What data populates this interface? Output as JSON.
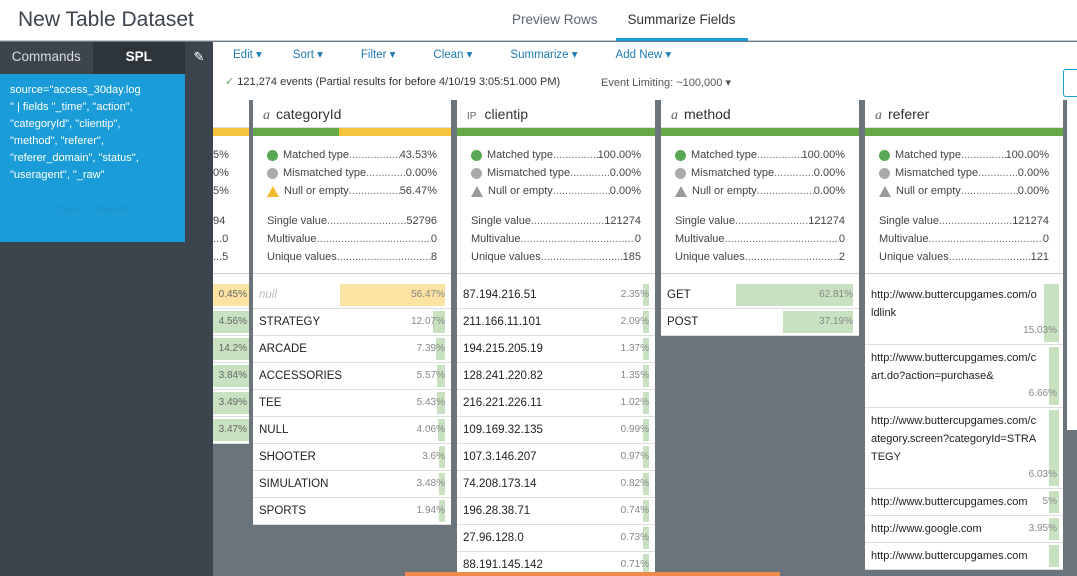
{
  "title": "New Table Dataset",
  "tabs": [
    {
      "label": "Preview Rows",
      "active": false
    },
    {
      "label": "Summarize Fields",
      "active": true
    }
  ],
  "left": {
    "tab_commands": "Commands",
    "tab_spl": "SPL",
    "spl": "source=\"access_30day.log\n\" | fields \"_time\", \"action\",\n\"categoryId\", \"clientip\",\n\"method\", \"referer\",\n\"referer_domain\", \"status\",\n\"useragent\", \"_raw\"",
    "open_in_search": "Open in Search"
  },
  "toolbar": {
    "menus": [
      "Edit",
      "Sort",
      "Filter",
      "Clean",
      "Summarize",
      "Add New"
    ],
    "status": "121,274 events (Partial results for before 4/10/19 3:05:51.000 PM)",
    "event_limit": "Event Limiting: ~100,000"
  },
  "partial_col": {
    "stats": [
      "5%",
      "0%",
      "5%",
      "94",
      "...0",
      "...5"
    ],
    "rows": [
      "0.45%",
      "4.56%",
      "14.2%",
      "3.84%",
      "3.49%",
      "3.47%"
    ]
  },
  "columns": [
    {
      "type_label": "a",
      "name": "categoryId",
      "matched_fraction": 0.4353,
      "matched": "43.53%",
      "mismatched": "0.00%",
      "null": "56.47%",
      "null_warn": true,
      "single": "52796",
      "multi": "0",
      "unique": "8",
      "rows": [
        {
          "label": "null",
          "pct": "56.47%",
          "frac": 0.5647,
          "null": true
        },
        {
          "label": "STRATEGY",
          "pct": "12.07%",
          "frac": 0.1207
        },
        {
          "label": "ARCADE",
          "pct": "7.39%",
          "frac": 0.0739
        },
        {
          "label": "ACCESSORIES",
          "pct": "5.57%",
          "frac": 0.0557
        },
        {
          "label": "TEE",
          "pct": "5.43%",
          "frac": 0.0543
        },
        {
          "label": "NULL",
          "pct": "4.06%",
          "frac": 0.0406
        },
        {
          "label": "SHOOTER",
          "pct": "3.6%",
          "frac": 0.036
        },
        {
          "label": "SIMULATION",
          "pct": "3.48%",
          "frac": 0.0348
        },
        {
          "label": "SPORTS",
          "pct": "1.94%",
          "frac": 0.0194
        }
      ]
    },
    {
      "type_label": "IP",
      "name": "clientip",
      "matched_fraction": 1.0,
      "matched": "100.00%",
      "mismatched": "0.00%",
      "null": "0.00%",
      "null_warn": false,
      "single": "121274",
      "multi": "0",
      "unique": "185",
      "rows": [
        {
          "label": "87.194.216.51",
          "pct": "2.35%",
          "frac": 0.0235
        },
        {
          "label": "211.166.11.101",
          "pct": "2.09%",
          "frac": 0.0209
        },
        {
          "label": "194.215.205.19",
          "pct": "1.37%",
          "frac": 0.0137
        },
        {
          "label": "128.241.220.82",
          "pct": "1.35%",
          "frac": 0.0135
        },
        {
          "label": "216.221.226.11",
          "pct": "1.02%",
          "frac": 0.0102
        },
        {
          "label": "109.169.32.135",
          "pct": "0.99%",
          "frac": 0.0099
        },
        {
          "label": "107.3.146.207",
          "pct": "0.97%",
          "frac": 0.0097
        },
        {
          "label": "74.208.173.14",
          "pct": "0.82%",
          "frac": 0.0082
        },
        {
          "label": "196.28.38.71",
          "pct": "0.74%",
          "frac": 0.0074
        },
        {
          "label": "27.96.128.0",
          "pct": "0.73%",
          "frac": 0.0073
        },
        {
          "label": "88.191.145.142",
          "pct": "0.71%",
          "frac": 0.0071
        }
      ]
    },
    {
      "type_label": "a",
      "name": "method",
      "matched_fraction": 1.0,
      "matched": "100.00%",
      "mismatched": "0.00%",
      "null": "0.00%",
      "null_warn": false,
      "single": "121274",
      "multi": "0",
      "unique": "2",
      "rows": [
        {
          "label": "GET",
          "pct": "62.81%",
          "frac": 0.6281
        },
        {
          "label": "POST",
          "pct": "37.19%",
          "frac": 0.3719
        }
      ]
    },
    {
      "type_label": "a",
      "name": "referer",
      "matched_fraction": 1.0,
      "matched": "100.00%",
      "mismatched": "0.00%",
      "null": "0.00%",
      "null_warn": false,
      "single": "121274",
      "multi": "0",
      "unique": "121",
      "rows": [
        {
          "label": "http://www.buttercupgames.com/oldlink",
          "pct": "15.03%",
          "frac": 0.1503
        },
        {
          "label": "http://www.buttercupgames.com/cart.do?action=purchase&",
          "pct": "6.66%",
          "frac": 0.0666
        },
        {
          "label": "http://www.buttercupgames.com/category.screen?categoryId=STRATEGY",
          "pct": "6.03%",
          "frac": 0.0603
        },
        {
          "label": "http://www.buttercupgames.com",
          "pct": "5%",
          "frac": 0.05,
          "one": true
        },
        {
          "label": "http://www.google.com",
          "pct": "3.95%",
          "frac": 0.0395,
          "one": true
        },
        {
          "label": "http://www.buttercupgames.com",
          "pct": "",
          "frac": 0.03
        }
      ]
    }
  ],
  "stat_labels": {
    "matched": "Matched type",
    "mismatched": "Mismatched type",
    "null": "Null or empty",
    "single": "Single value",
    "multi": "Multivalue",
    "unique": "Unique values"
  },
  "colors": {
    "accent": "#1a9cd8",
    "matched": "#65a847",
    "null": "#f5c33b"
  }
}
